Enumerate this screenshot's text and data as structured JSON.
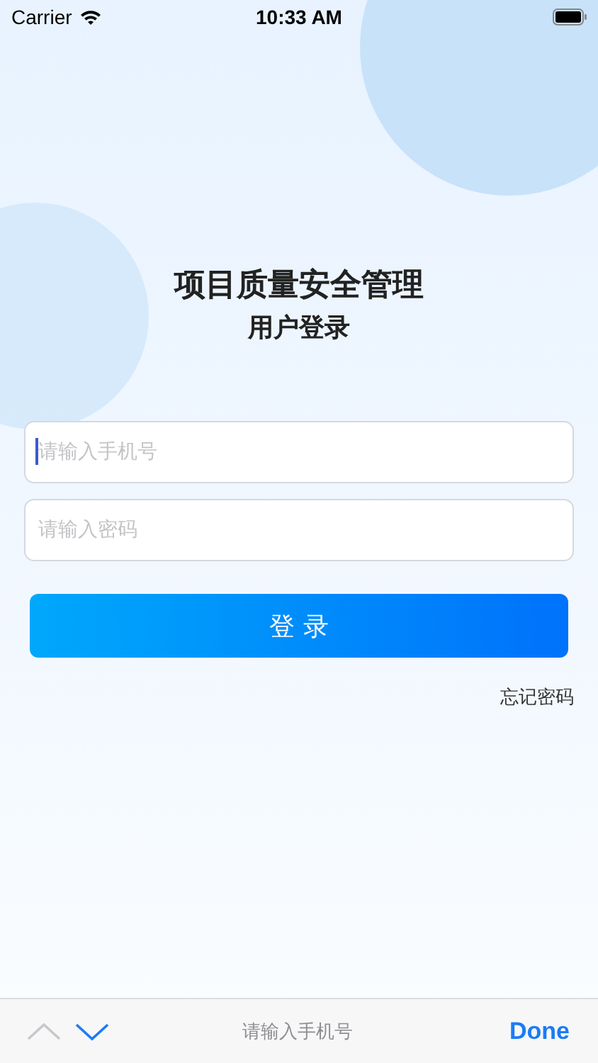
{
  "status_bar": {
    "carrier": "Carrier",
    "time": "10:33 AM"
  },
  "title": "项目质量安全管理",
  "subtitle": "用户登录",
  "fields": [
    {
      "placeholder": "请输入手机号",
      "focused": true
    },
    {
      "placeholder": "请输入密码",
      "focused": false
    }
  ],
  "login_button": "登 录",
  "forgot_link": "忘记密码",
  "keyboard_toolbar": {
    "previous_disabled": true,
    "next_disabled": false,
    "hint": "请输入手机号",
    "done": "Done"
  }
}
